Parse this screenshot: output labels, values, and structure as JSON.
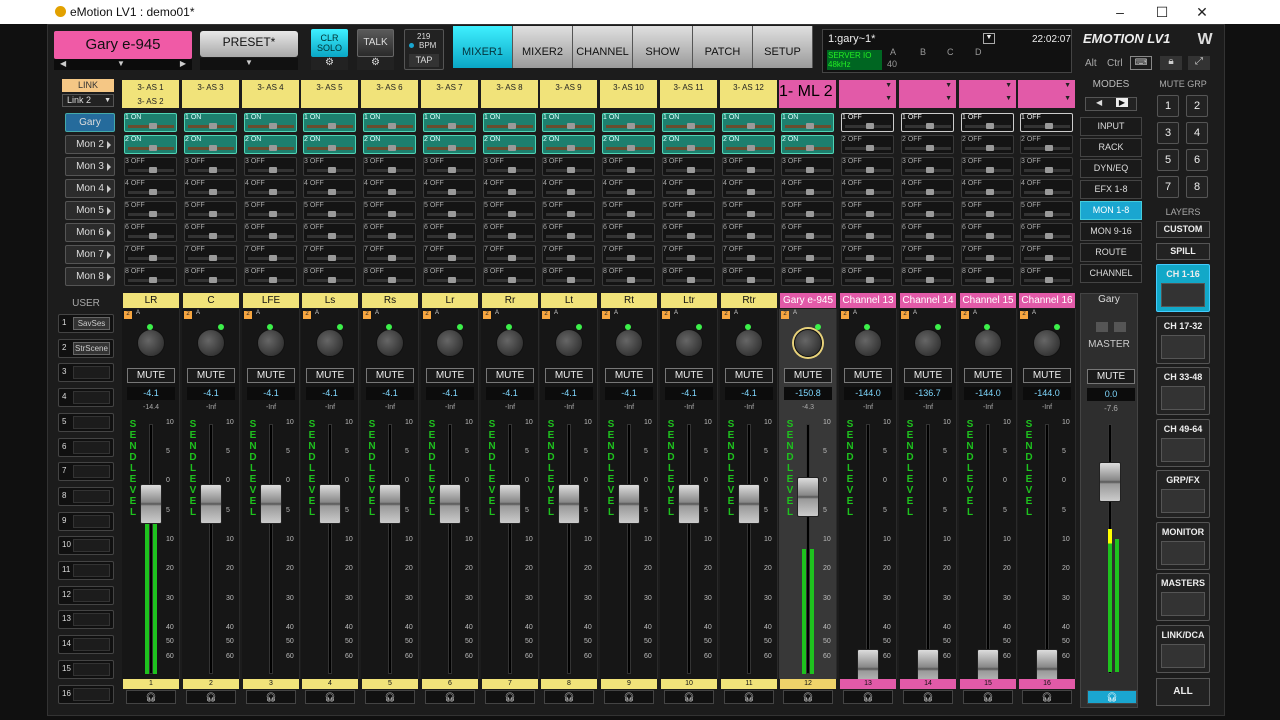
{
  "window": {
    "title": "eMotion LV1 : demo01*",
    "min": "–",
    "max": "☐",
    "close": "✕"
  },
  "header": {
    "scene_name": "Gary e-945",
    "preset": "PRESET*",
    "clr_solo": "CLR SOLO",
    "talk": "TALK",
    "bpm_value": "219",
    "bpm_label": "BPM",
    "tap": "TAP",
    "tabs": [
      {
        "label": "MIXER1",
        "active": true
      },
      {
        "label": "MIXER2"
      },
      {
        "label": "CHANNEL"
      },
      {
        "label": "SHOW"
      },
      {
        "label": "PATCH"
      },
      {
        "label": "SETUP"
      }
    ],
    "session": "1:gary~1*",
    "time": "22:02:07",
    "server_io": "SERVER IO",
    "samplerate": "48kHz",
    "io_letters": [
      "A",
      "B",
      "C",
      "D"
    ],
    "io_count": "40",
    "alt": "Alt",
    "ctrl": "Ctrl",
    "brand": "EMOTION LV1"
  },
  "link": {
    "label": "LINK",
    "dropdown": "Link 2"
  },
  "monitors": [
    "Gary",
    "Mon 2",
    "Mon 3",
    "Mon 4",
    "Mon 5",
    "Mon 6",
    "Mon 7",
    "Mon 8"
  ],
  "mode_title": "MODES",
  "modes": [
    {
      "label": "INPUT"
    },
    {
      "label": "RACK"
    },
    {
      "label": "DYN/EQ"
    },
    {
      "label": "EFX 1-8"
    },
    {
      "label": "MON 1-8",
      "active": true
    },
    {
      "label": "MON 9-16"
    },
    {
      "label": "ROUTE"
    },
    {
      "label": "CHANNEL"
    }
  ],
  "user_title": "USER",
  "user_buttons": [
    {
      "n": "1",
      "t": "SavSes"
    },
    {
      "n": "2",
      "t": "StrScene"
    },
    {
      "n": "3"
    },
    {
      "n": "4"
    },
    {
      "n": "5"
    },
    {
      "n": "6"
    },
    {
      "n": "7"
    },
    {
      "n": "8"
    },
    {
      "n": "9"
    },
    {
      "n": "10"
    },
    {
      "n": "11"
    },
    {
      "n": "12"
    },
    {
      "n": "13"
    },
    {
      "n": "14"
    },
    {
      "n": "15"
    },
    {
      "n": "16"
    }
  ],
  "channels": [
    {
      "num": "1",
      "name": "LR",
      "route": "3- AS 1",
      "route2": "3- AS 2",
      "level": "-4.1",
      "peak": "-14.4",
      "sends": [
        "1 ON",
        "2 ON",
        "3 OFF",
        "4 OFF",
        "5 OFF",
        "6 OFF",
        "7 OFF",
        "8 OFF"
      ],
      "meter": 0.75
    },
    {
      "num": "2",
      "name": "C",
      "route": "3- AS 3",
      "level": "-4.1",
      "peak": "-Inf",
      "sends": [
        "1 ON",
        "2 ON",
        "3 OFF",
        "4 OFF",
        "5 OFF",
        "6 OFF",
        "7 OFF",
        "8 OFF"
      ]
    },
    {
      "num": "3",
      "name": "LFE",
      "route": "3- AS 4",
      "level": "-4.1",
      "peak": "-Inf",
      "sends": [
        "1 ON",
        "2 ON",
        "3 OFF",
        "4 OFF",
        "5 OFF",
        "6 OFF",
        "7 OFF",
        "8 OFF"
      ]
    },
    {
      "num": "4",
      "name": "Ls",
      "route": "3- AS 5",
      "level": "-4.1",
      "peak": "-Inf",
      "sends": [
        "1 ON",
        "2 ON",
        "3 OFF",
        "4 OFF",
        "5 OFF",
        "6 OFF",
        "7 OFF",
        "8 OFF"
      ]
    },
    {
      "num": "5",
      "name": "Rs",
      "route": "3- AS 6",
      "level": "-4.1",
      "peak": "-Inf",
      "sends": [
        "1 ON",
        "2 ON",
        "3 OFF",
        "4 OFF",
        "5 OFF",
        "6 OFF",
        "7 OFF",
        "8 OFF"
      ]
    },
    {
      "num": "6",
      "name": "Lr",
      "route": "3- AS 7",
      "level": "-4.1",
      "peak": "-Inf",
      "sends": [
        "1 ON",
        "2 ON",
        "3 OFF",
        "4 OFF",
        "5 OFF",
        "6 OFF",
        "7 OFF",
        "8 OFF"
      ]
    },
    {
      "num": "7",
      "name": "Rr",
      "route": "3- AS 8",
      "level": "-4.1",
      "peak": "-Inf",
      "sends": [
        "1 ON",
        "2 ON",
        "3 OFF",
        "4 OFF",
        "5 OFF",
        "6 OFF",
        "7 OFF",
        "8 OFF"
      ]
    },
    {
      "num": "8",
      "name": "Lt",
      "route": "3- AS 9",
      "level": "-4.1",
      "peak": "-Inf",
      "sends": [
        "1 ON",
        "2 ON",
        "3 OFF",
        "4 OFF",
        "5 OFF",
        "6 OFF",
        "7 OFF",
        "8 OFF"
      ]
    },
    {
      "num": "9",
      "name": "Rt",
      "route": "3- AS 10",
      "level": "-4.1",
      "peak": "-Inf",
      "sends": [
        "1 ON",
        "2 ON",
        "3 OFF",
        "4 OFF",
        "5 OFF",
        "6 OFF",
        "7 OFF",
        "8 OFF"
      ]
    },
    {
      "num": "10",
      "name": "Ltr",
      "route": "3- AS 11",
      "level": "-4.1",
      "peak": "-Inf",
      "sends": [
        "1 ON",
        "2 ON",
        "3 OFF",
        "4 OFF",
        "5 OFF",
        "6 OFF",
        "7 OFF",
        "8 OFF"
      ]
    },
    {
      "num": "11",
      "name": "Rtr",
      "route": "3- AS 12",
      "level": "-4.1",
      "peak": "-Inf",
      "sends": [
        "1 ON",
        "2 ON",
        "3 OFF",
        "4 OFF",
        "5 OFF",
        "6 OFF",
        "7 OFF",
        "8 OFF"
      ]
    },
    {
      "num": "12",
      "name": "Gary e-945",
      "route": "1- ML 2",
      "level": "-150.8",
      "peak": "-4.3",
      "sends": [
        "1 ON",
        "2 ON",
        "3 OFF",
        "4 OFF",
        "5 OFF",
        "6 OFF",
        "7 OFF",
        "8 OFF"
      ],
      "meter": 0.5
    },
    {
      "num": "13",
      "name": "Channel 13",
      "route": "",
      "level": "-144.0",
      "peak": "-Inf",
      "sends": [
        "1 OFF",
        "2 OFF",
        "3 OFF",
        "4 OFF",
        "5 OFF",
        "6 OFF",
        "7 OFF",
        "8 OFF"
      ]
    },
    {
      "num": "14",
      "name": "Channel 14",
      "route": "",
      "level": "-136.7",
      "peak": "-Inf",
      "sends": [
        "1 OFF",
        "2 OFF",
        "3 OFF",
        "4 OFF",
        "5 OFF",
        "6 OFF",
        "7 OFF",
        "8 OFF"
      ]
    },
    {
      "num": "15",
      "name": "Channel 15",
      "route": "",
      "level": "-144.0",
      "peak": "-Inf",
      "sends": [
        "1 OFF",
        "2 OFF",
        "3 OFF",
        "4 OFF",
        "5 OFF",
        "6 OFF",
        "7 OFF",
        "8 OFF"
      ]
    },
    {
      "num": "16",
      "name": "Channel 16",
      "route": "",
      "level": "-144.0",
      "peak": "-Inf",
      "sends": [
        "1 OFF",
        "2 OFF",
        "3 OFF",
        "4 OFF",
        "5 OFF",
        "6 OFF",
        "7 OFF",
        "8 OFF"
      ]
    }
  ],
  "strip_labels": {
    "mute": "MUTE",
    "send_level": "SEND LEVEL",
    "scale": [
      "10",
      "5",
      "0",
      "5",
      "10",
      "20",
      "30",
      "40",
      "50",
      "60"
    ]
  },
  "master": {
    "name": "Gary",
    "label": "MASTER",
    "mute": "MUTE",
    "level": "0.0",
    "peak": "-7.6"
  },
  "mute_grp": {
    "title": "MUTE GRP",
    "buttons": [
      "1",
      "2",
      "3",
      "4",
      "5",
      "6",
      "7",
      "8"
    ]
  },
  "layers": {
    "title": "LAYERS",
    "custom": "CUSTOM",
    "spill": "SPILL",
    "items": [
      {
        "label": "CH 1-16",
        "active": true
      },
      {
        "label": "CH 17-32"
      },
      {
        "label": "CH 33-48"
      },
      {
        "label": "CH 49-64"
      },
      {
        "label": "GRP/FX"
      },
      {
        "label": "MONITOR"
      },
      {
        "label": "MASTERS"
      },
      {
        "label": "LINK/DCA"
      }
    ],
    "all": "ALL"
  }
}
